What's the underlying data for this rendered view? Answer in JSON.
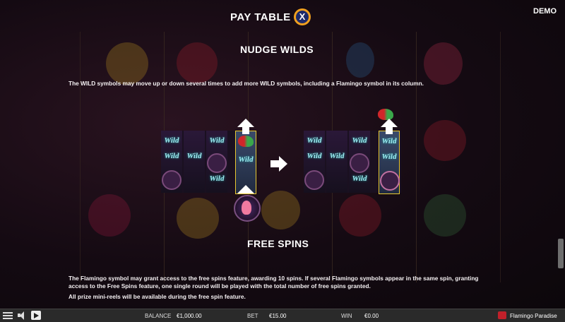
{
  "header": {
    "title": "PAY TABLE",
    "close_label": "X",
    "demo_label": "DEMO"
  },
  "nudge_wilds": {
    "title": "NUDGE WILDS",
    "description": "The WILD symbols may move up or down several times to add more WILD symbols, including a Flamingo symbol in its column.",
    "wild_label": "Wild"
  },
  "free_spins": {
    "title": "FREE SPINS",
    "paragraph1": "The Flamingo symbol may grant access to the free spins feature, awarding 10 spins. If several Flamingo symbols appear in the same spin, granting access to the Free Spins feature, one single round will be played with the total number of free spins granted.",
    "paragraph2": "All prize mini-reels will be available during the free spin feature."
  },
  "bottom_bar": {
    "balance_label": "BALANCE",
    "balance_value": "€1,000.00",
    "bet_label": "BET",
    "bet_value": "€15.00",
    "win_label": "WIN",
    "win_value": "€0.00",
    "game_name": "Flamingo Paradise"
  },
  "icons": [
    "menu-icon",
    "sound-icon",
    "play-icon",
    "arrow-up-icon",
    "arrow-right-icon",
    "close-icon",
    "logo-icon"
  ],
  "colors": {
    "accent": "#f0a020",
    "close_inner": "#1d2a6a",
    "wild_text": "#9fe9ef",
    "highlight": "#e8c830"
  }
}
